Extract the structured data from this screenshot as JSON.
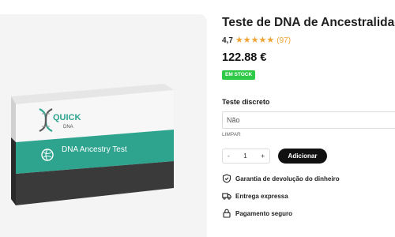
{
  "product": {
    "title": "Teste de DNA de Ancestralidade",
    "rating_value": "4,7",
    "review_count": "(97)",
    "rating": 4.7,
    "price": "122.88 €",
    "stock_label": "EM STOCK",
    "box_brand_top": "QUICK",
    "box_brand_bottom": "DNA",
    "box_label": "DNA Ancestry Test"
  },
  "options": {
    "label": "Teste discreto",
    "selected": "Não",
    "clear": "LIMPAR"
  },
  "cart": {
    "minus": "-",
    "quantity": "1",
    "plus": "+",
    "add_label": "Adicionar"
  },
  "features": [
    {
      "label": "Garantia de devolução do dinheiro",
      "icon": "shield-check-icon"
    },
    {
      "label": "Entrega expressa",
      "icon": "truck-icon"
    },
    {
      "label": "Pagamento seguro",
      "icon": "lock-icon"
    }
  ],
  "colors": {
    "accent_teal": "#2ea48f",
    "stock_green": "#2ec946",
    "star_orange": "#f0a335"
  }
}
